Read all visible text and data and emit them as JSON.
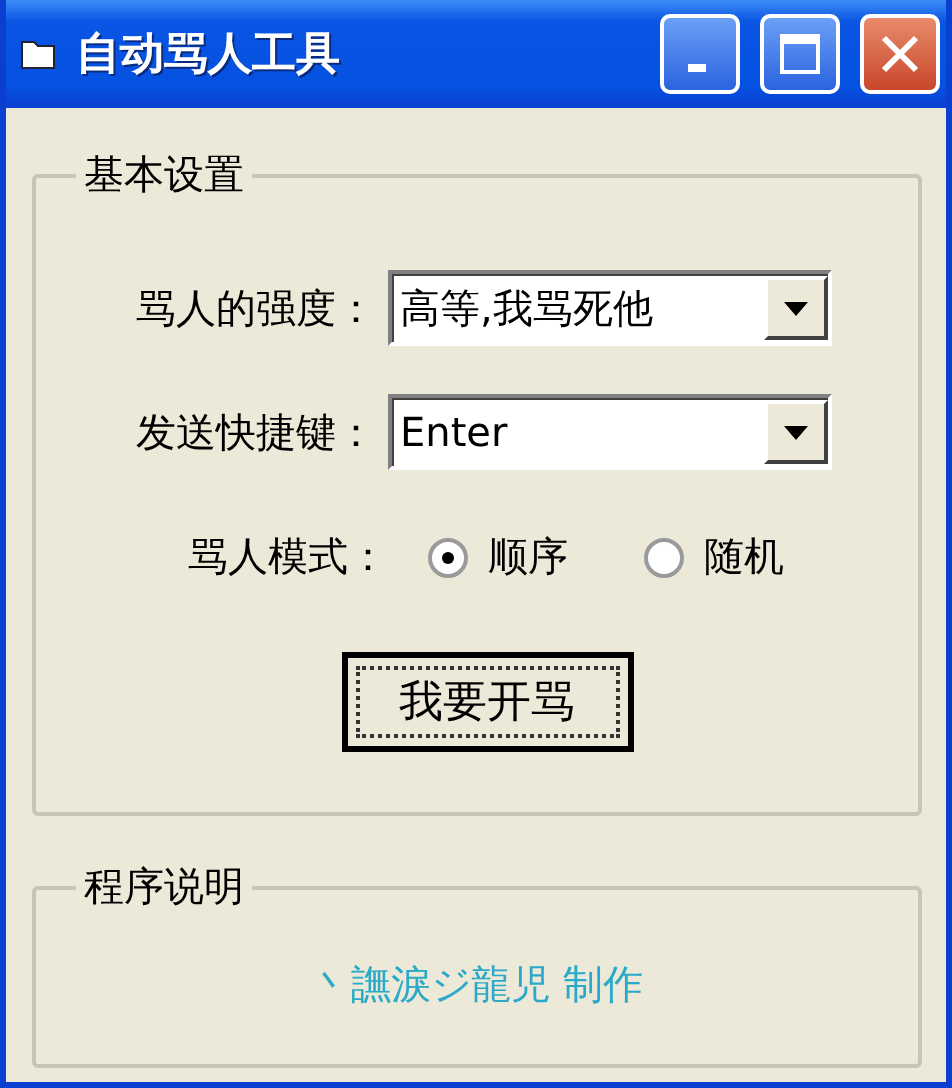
{
  "window": {
    "title": "自动骂人工具"
  },
  "settings": {
    "title": "基本设置",
    "fields": [
      {
        "label": "骂人的强度：",
        "value": "高等,我骂死他"
      },
      {
        "label": "发送快捷键：",
        "value": "Enter"
      }
    ],
    "mode": {
      "label": "骂人模式：",
      "options": [
        {
          "label": "顺序",
          "selected": true
        },
        {
          "label": "随机",
          "selected": false
        }
      ]
    },
    "button": "我要开骂"
  },
  "about": {
    "title": "程序说明",
    "credit": "丶譕淚ジ龍児 制作"
  }
}
